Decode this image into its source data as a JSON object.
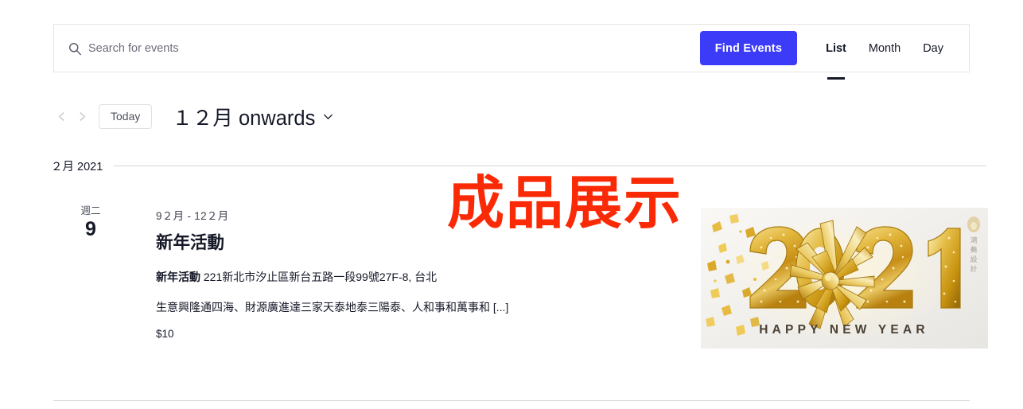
{
  "search": {
    "placeholder": "Search for events",
    "value": "",
    "icon": "search-icon"
  },
  "toolbar": {
    "find_events_label": "Find Events",
    "find_events_color": "#3C3BF7",
    "views": [
      {
        "label": "List",
        "active": true
      },
      {
        "label": "Month",
        "active": false
      },
      {
        "label": "Day",
        "active": false
      }
    ]
  },
  "nav": {
    "prev_icon": "chevron-left-icon",
    "next_icon": "chevron-right-icon",
    "today_label": "Today",
    "period_label": "１２月 onwards",
    "period_caret_icon": "chevron-down-icon"
  },
  "month_separator": {
    "label": "２月 2021"
  },
  "event": {
    "weekday": "週二",
    "day": "9",
    "time_range": "9２月 - 12２月",
    "title": "新年活動",
    "venue_name": "新年活動",
    "venue_address": "221新北市汐止區新台五路一段99號27F-8, 台北",
    "description": "生意興隆通四海、財源廣進達三家天泰地泰三陽泰、人和事和萬事和 [...]",
    "cost": "$10",
    "image": {
      "year_text": "2021",
      "greeting_text": "HAPPY NEW YEAR",
      "watermark_text": "鴻蕎設計",
      "gold_color": "#D9A520",
      "background_color": "#F2F0ED"
    }
  },
  "overlay": {
    "text": "成品展示",
    "color": "#FB2A06"
  }
}
